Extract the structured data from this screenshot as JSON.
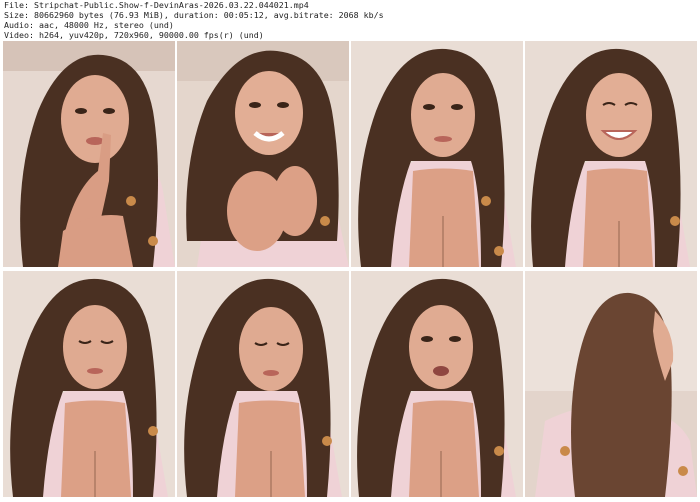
{
  "header": {
    "file_line": "File: Stripchat-Public.Show-f-DevinAras-2026.03.22.044021.mp4",
    "size_line": "Size: 80662960 bytes (76.93 MiB), duration: 00:05:12, avg.bitrate: 2068 kb/s",
    "audio_line": "Audio: aac, 48000 Hz, stereo (und)",
    "video_line": "Video: h264, yuv420p, 720x960, 90000.00 fps(r) (und)"
  },
  "thumbnails": [
    {
      "scene": "finger-to-lips"
    },
    {
      "scene": "hands-clasped-smiling"
    },
    {
      "scene": "facing-camera"
    },
    {
      "scene": "laughing"
    },
    {
      "scene": "looking-down"
    },
    {
      "scene": "looking-down"
    },
    {
      "scene": "talking"
    },
    {
      "scene": "turned-away"
    }
  ],
  "colors": {
    "background": "#ffffff",
    "text": "#222222",
    "wall": "#e6d8d0",
    "hair": "#4a3022",
    "skin": "#e0ab92",
    "shirt": "#efd2d6"
  }
}
